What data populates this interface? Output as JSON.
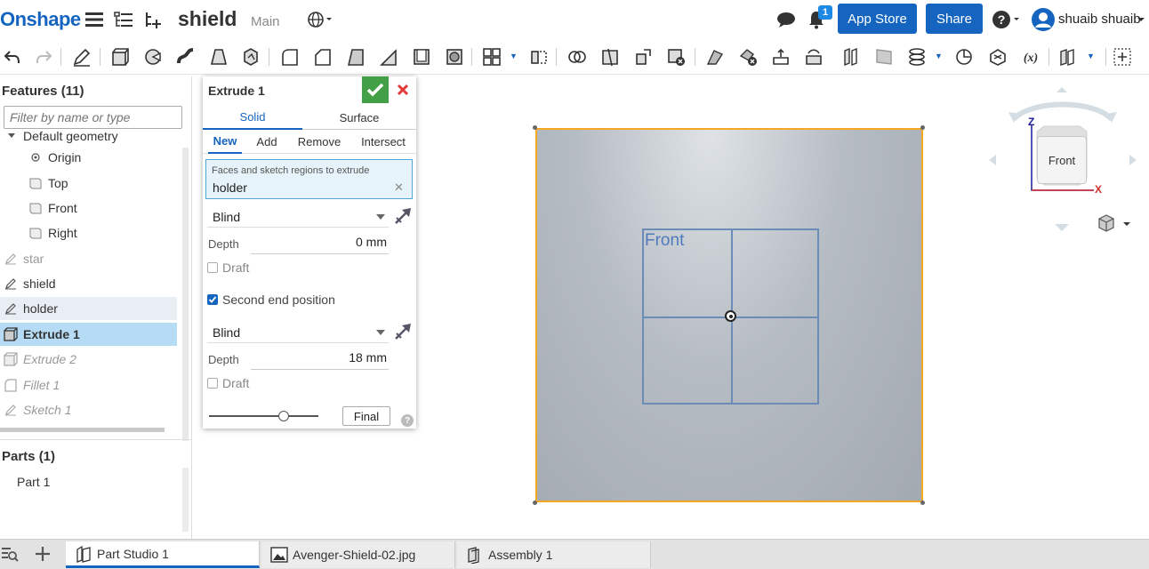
{
  "header": {
    "logo": "Onshape",
    "document_title": "shield",
    "branch": "Main",
    "notifications_count": "1",
    "app_store_label": "App Store",
    "share_label": "Share",
    "user_name": "shuaib shuaib"
  },
  "features_panel": {
    "title": "Features (11)",
    "filter_placeholder": "Filter by name or type",
    "items": [
      {
        "label": "Default geometry",
        "icon": "caret-down-icon"
      },
      {
        "label": "Origin",
        "icon": "origin-icon"
      },
      {
        "label": "Top",
        "icon": "plane-icon"
      },
      {
        "label": "Front",
        "icon": "plane-icon"
      },
      {
        "label": "Right",
        "icon": "plane-icon"
      },
      {
        "label": "star",
        "icon": "sketch-icon",
        "state": "suppressed"
      },
      {
        "label": "shield",
        "icon": "sketch-icon"
      },
      {
        "label": "holder",
        "icon": "sketch-icon",
        "state": "hover"
      },
      {
        "label": "Extrude 1",
        "icon": "extrude-icon",
        "state": "selected"
      },
      {
        "label": "Extrude 2",
        "icon": "extrude-icon",
        "state": "rolled-back"
      },
      {
        "label": "Fillet 1",
        "icon": "fillet-icon",
        "state": "rolled-back"
      },
      {
        "label": "Sketch 1",
        "icon": "sketch-icon",
        "state": "rolled-back"
      }
    ],
    "parts_title": "Parts (1)",
    "parts": [
      "Part 1"
    ]
  },
  "extrude_dialog": {
    "title": "Extrude 1",
    "tabs": [
      "Solid",
      "Surface"
    ],
    "active_tab": "Solid",
    "operations": [
      "New",
      "Add",
      "Remove",
      "Intersect"
    ],
    "active_operation": "New",
    "faces_label": "Faces and sketch regions to extrude",
    "faces_value": "holder",
    "end_type_1": "Blind",
    "depth_label": "Depth",
    "depth_1": "0 mm",
    "draft_label": "Draft",
    "second_end_label": "Second end position",
    "second_end_checked": true,
    "end_type_2": "Blind",
    "depth_2": "18 mm",
    "final_label": "Final",
    "help": "?"
  },
  "viewport": {
    "sketch_label": "Front",
    "view_cube_face": "Front",
    "axis_z": "Z",
    "axis_x": "X",
    "plane_highlight_color": "#f5a623",
    "sketch_color": "#6c8cb8"
  },
  "bottom_tabs": [
    {
      "label": "Part Studio 1",
      "icon": "part-studio-icon",
      "active": true
    },
    {
      "label": "Avenger-Shield-02.jpg",
      "icon": "image-icon"
    },
    {
      "label": "Assembly 1",
      "icon": "assembly-icon"
    }
  ],
  "colors": {
    "brand": "#1565c0",
    "accept": "#43a047",
    "cancel": "#e53935",
    "selection": "#b6dcf5"
  }
}
